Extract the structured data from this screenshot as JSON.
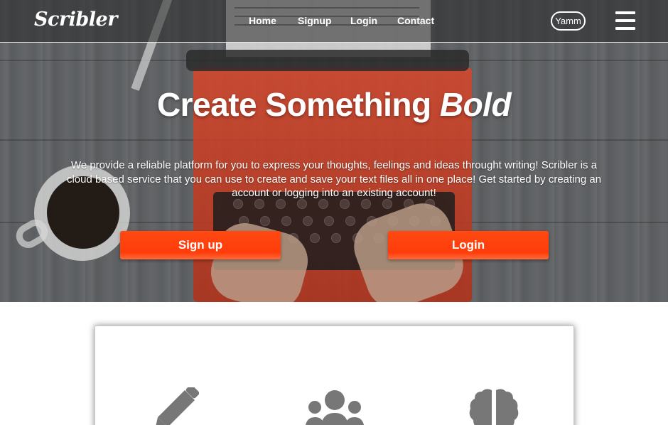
{
  "navbar": {
    "brand": "Scribler",
    "links": [
      "Home",
      "Signup",
      "Login",
      "Contact"
    ],
    "user": "Yamm",
    "menu_icon": "hamburger-menu-icon"
  },
  "hero": {
    "title_plain": "Create Something ",
    "title_emphasis": "Bold",
    "description": "We provide a reliable platform for you to express your thoughts, feelings and ideas throught writing! Scribler is a cloud based service that you can use to create and save your text files all in one place! Get started by creating an account or logging into an existing account!",
    "signup_button": "Sign up",
    "login_button": "Login"
  },
  "features": {
    "icons": [
      "pencil-icon",
      "users-icon",
      "brain-icon"
    ]
  },
  "colors": {
    "accent": "#ff3f0c",
    "icon_gray": "#777777",
    "nav_text": "#ffffff"
  }
}
